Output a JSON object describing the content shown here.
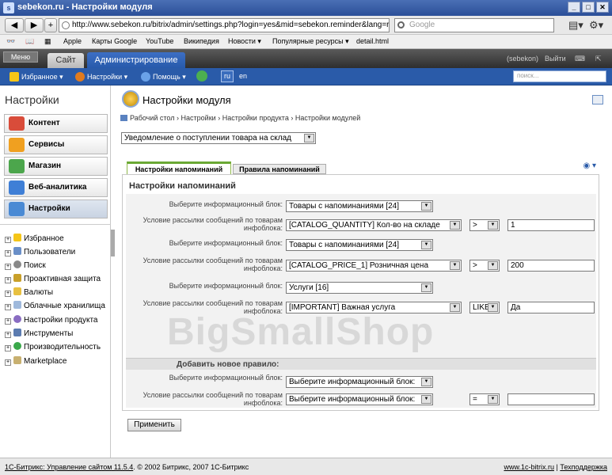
{
  "window": {
    "title": "sebekon.ru - Настройки модуля"
  },
  "browser": {
    "url": "http://www.sebekon.ru/bitrix/admin/settings.php?login=yes&mid=sebekon.reminder&lang=r",
    "search_placeholder": "Google",
    "bookmarks": [
      "Apple",
      "Карты Google",
      "YouTube",
      "Википедия",
      "Новости ▾",
      "Популярные ресурсы ▾",
      "detail.html"
    ]
  },
  "adminbar": {
    "menu_label": "Меню",
    "tab_site": "Сайт",
    "tab_admin": "Администрирование",
    "user": "(sebekon)",
    "logout": "Выйти"
  },
  "subbar": {
    "favorites": "Избранное ▾",
    "settings": "Настройки ▾",
    "help": "Помощь ▾",
    "lang_ru": "ru",
    "lang_en": "en",
    "search_placeholder": "поиск..."
  },
  "left": {
    "title": "Настройки",
    "buttons": [
      "Контент",
      "Сервисы",
      "Магазин",
      "Веб-аналитика",
      "Настройки"
    ],
    "tree": [
      "Избранное",
      "Пользователи",
      "Поиск",
      "Проактивная защита",
      "Валюты",
      "Облачные хранилища",
      "Настройки продукта",
      "Инструменты",
      "Производительность",
      "Marketplace"
    ]
  },
  "main": {
    "title": "Настройки модуля",
    "breadcrumb": [
      "Рабочий стол",
      "Настройки",
      "Настройки продукта",
      "Настройки модулей"
    ],
    "breadcrumb_sep": "›",
    "module_select": "Уведомление о поступлении товара на склад",
    "tabs": [
      "Настройки напоминаний",
      "Правила напоминаний"
    ],
    "section_title": "Настройки напоминаний",
    "label_block": "Выберите информационный блок:",
    "label_cond_1": "Условие рассылки сообщений по товарам",
    "label_cond_2": "инфоблока:",
    "rules": [
      {
        "block": "Товары с напоминаниями [24]",
        "prop": "[CATALOG_QUANTITY] Кол-во на складе",
        "op": ">",
        "value": "1"
      },
      {
        "block": "Товары с напоминаниями [24]",
        "prop": "[CATALOG_PRICE_1] Розничная цена",
        "op": ">",
        "value": "200"
      },
      {
        "block": "Услуги [16]",
        "prop": "[IMPORTANT] Важная услуга",
        "op": "LIKE",
        "value": "Да"
      }
    ],
    "add_new": "Добавить новое правило:",
    "new_rule": {
      "block": "Выберите информационный блок:",
      "prop": "Выберите информационный блок:",
      "op": "=",
      "value": ""
    },
    "apply": "Применить",
    "watermark": "BigSmallShop"
  },
  "footer": {
    "left": "1С-Битрикс: Управление сайтом 11.5.4",
    "copyright": ". © 2002 Битрикс, 2007 1С-Битрикс",
    "site": "www.1c-bitrix.ru",
    "sep": "|",
    "support": "Техподдержка"
  }
}
